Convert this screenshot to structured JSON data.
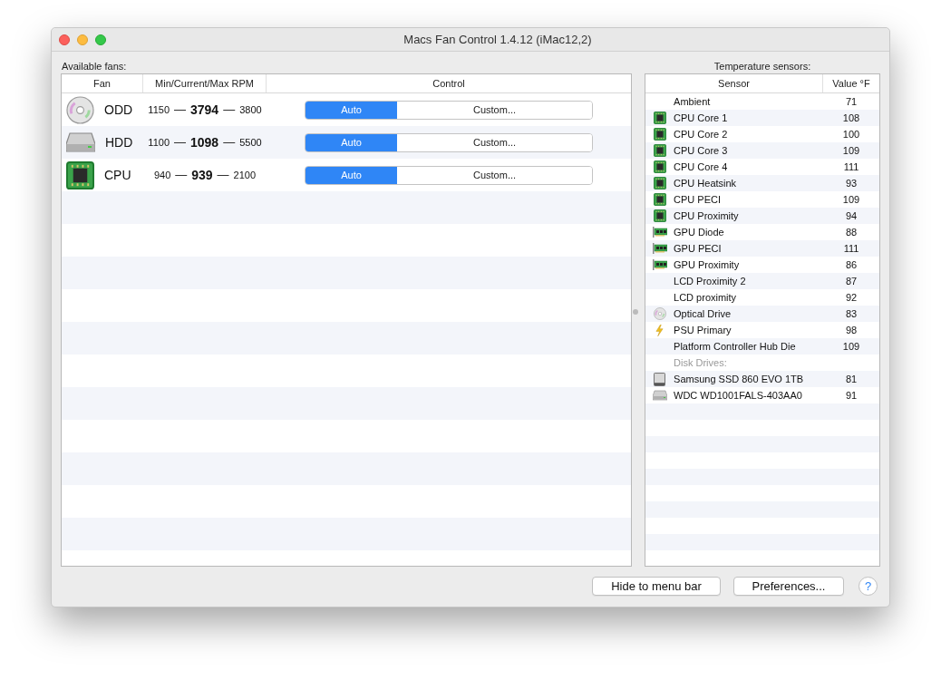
{
  "window": {
    "title": "Macs Fan Control 1.4.12 (iMac12,2)"
  },
  "fans": {
    "label": "Available fans:",
    "columns": [
      "Fan",
      "Min/Current/Max RPM",
      "Control"
    ],
    "rows": [
      {
        "kind": "optical",
        "name": "ODD",
        "rpm": [
          {
            "kind": "min",
            "text": "1150"
          },
          {
            "kind": "sep",
            "text": "—"
          },
          {
            "kind": "current",
            "text": "3794"
          },
          {
            "kind": "sep",
            "text": "—"
          },
          {
            "kind": "max",
            "text": "3800"
          }
        ],
        "control": [
          {
            "label": "Auto",
            "selected": true
          },
          {
            "label": "Custom...",
            "selected": false
          }
        ]
      },
      {
        "kind": "hdd",
        "name": "HDD",
        "rpm": [
          {
            "kind": "min",
            "text": "1100"
          },
          {
            "kind": "sep",
            "text": "—"
          },
          {
            "kind": "current",
            "text": "1098"
          },
          {
            "kind": "sep",
            "text": "—"
          },
          {
            "kind": "max",
            "text": "5500"
          }
        ],
        "control": [
          {
            "label": "Auto",
            "selected": true
          },
          {
            "label": "Custom...",
            "selected": false
          }
        ]
      },
      {
        "kind": "cpu",
        "name": "CPU",
        "rpm": [
          {
            "kind": "min",
            "text": "940"
          },
          {
            "kind": "sep",
            "text": "—"
          },
          {
            "kind": "current",
            "text": "939"
          },
          {
            "kind": "sep",
            "text": "—"
          },
          {
            "kind": "max",
            "text": "2100"
          }
        ],
        "control": [
          {
            "label": "Auto",
            "selected": true
          },
          {
            "label": "Custom...",
            "selected": false
          }
        ]
      }
    ]
  },
  "sensors": {
    "label": "Temperature sensors:",
    "columns": [
      "Sensor",
      "Value °F"
    ],
    "rows": [
      {
        "kind": "plain",
        "name": "Ambient",
        "value": "71"
      },
      {
        "kind": "cpu",
        "name": "CPU Core 1",
        "value": "108"
      },
      {
        "kind": "cpu",
        "name": "CPU Core 2",
        "value": "100"
      },
      {
        "kind": "cpu",
        "name": "CPU Core 3",
        "value": "109"
      },
      {
        "kind": "cpu",
        "name": "CPU Core 4",
        "value": "111"
      },
      {
        "kind": "cpu",
        "name": "CPU Heatsink",
        "value": "93"
      },
      {
        "kind": "cpu",
        "name": "CPU PECI",
        "value": "109"
      },
      {
        "kind": "cpu",
        "name": "CPU Proximity",
        "value": "94"
      },
      {
        "kind": "gpu",
        "name": "GPU Diode",
        "value": "88"
      },
      {
        "kind": "gpu",
        "name": "GPU PECI",
        "value": "111"
      },
      {
        "kind": "gpu",
        "name": "GPU Proximity",
        "value": "86"
      },
      {
        "kind": "plain",
        "name": "LCD Proximity 2",
        "value": "87"
      },
      {
        "kind": "plain",
        "name": "LCD proximity",
        "value": "92"
      },
      {
        "kind": "optical",
        "name": "Optical Drive",
        "value": "83"
      },
      {
        "kind": "power",
        "name": "PSU Primary",
        "value": "98"
      },
      {
        "kind": "plain",
        "name": "Platform Controller Hub Die",
        "value": "109"
      },
      {
        "kind": "header",
        "name": "Disk Drives:"
      },
      {
        "kind": "ssd",
        "name": "Samsung SSD 860 EVO 1TB",
        "value": "81"
      },
      {
        "kind": "hdd",
        "name": "WDC WD1001FALS-403AA0",
        "value": "91"
      }
    ]
  },
  "buttons": [
    "Hide to menu bar",
    "Preferences..."
  ],
  "help": "?"
}
